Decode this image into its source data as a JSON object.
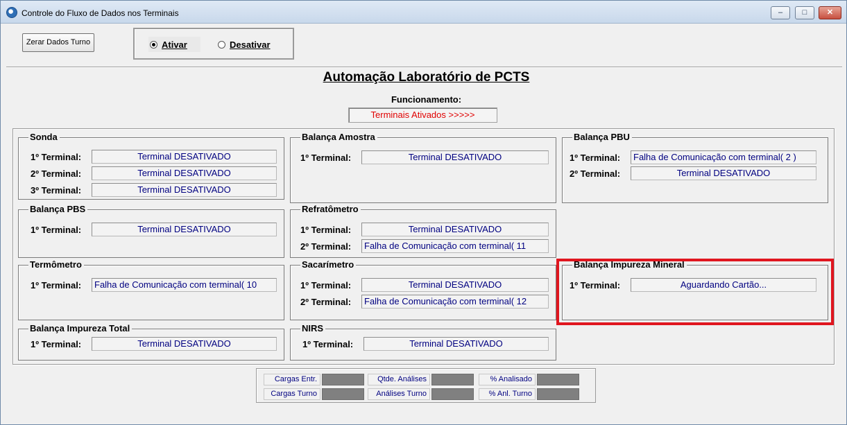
{
  "window": {
    "title": "Controle do Fluxo de Dados nos Terminais",
    "min_glyph": "–",
    "max_glyph": "□",
    "close_glyph": "✕"
  },
  "toolbar": {
    "zerar_label": "Zerar Dados Turno",
    "ativar_label": "Ativar",
    "desativar_label": "Desativar",
    "selected": "Ativar"
  },
  "header": {
    "title": "Automação Laboratório de PCTS",
    "func_label": "Funcionamento:",
    "func_status": "Terminais Ativados >>>>>"
  },
  "groups": {
    "sonda": {
      "title": "Sonda",
      "rows": [
        {
          "label": "1º Terminal:",
          "value": "Terminal DESATIVADO"
        },
        {
          "label": "2º Terminal:",
          "value": "Terminal DESATIVADO"
        },
        {
          "label": "3º Terminal:",
          "value": "Terminal DESATIVADO"
        }
      ]
    },
    "balanca_amostra": {
      "title": "Balança Amostra",
      "rows": [
        {
          "label": "1º Terminal:",
          "value": "Terminal DESATIVADO"
        }
      ]
    },
    "balanca_pbu": {
      "title": "Balança PBU",
      "rows": [
        {
          "label": "1º Terminal:",
          "value": "Falha de Comunicação com terminal( 2 )"
        },
        {
          "label": "2º Terminal:",
          "value": "Terminal DESATIVADO"
        }
      ]
    },
    "balanca_pbs": {
      "title": "Balança PBS",
      "rows": [
        {
          "label": "1º Terminal:",
          "value": "Terminal DESATIVADO"
        }
      ]
    },
    "refratometro": {
      "title": "Refratômetro",
      "rows": [
        {
          "label": "1º Terminal:",
          "value": "Terminal DESATIVADO"
        },
        {
          "label": "2º Terminal:",
          "value": "Falha de Comunicação com terminal( 11"
        }
      ]
    },
    "termometro": {
      "title": "Termômetro",
      "rows": [
        {
          "label": "1º Terminal:",
          "value": "Falha de Comunicação com terminal( 10"
        }
      ]
    },
    "sacarimetro": {
      "title": "Sacarímetro",
      "rows": [
        {
          "label": "1º Terminal:",
          "value": "Terminal DESATIVADO"
        },
        {
          "label": "2º Terminal:",
          "value": "Falha de Comunicação com terminal( 12"
        }
      ]
    },
    "balanca_mineral": {
      "title": "Balança Impureza Mineral",
      "rows": [
        {
          "label": "1º Terminal:",
          "value": "Aguardando Cartão..."
        }
      ]
    },
    "balanca_total": {
      "title": "Balança Impureza Total",
      "rows": [
        {
          "label": "1º Terminal:",
          "value": "Terminal DESATIVADO"
        }
      ]
    },
    "nirs": {
      "title": "NIRS",
      "rows": [
        {
          "label": "1º Terminal:",
          "value": "Terminal DESATIVADO"
        }
      ]
    }
  },
  "stats": {
    "cargas_entr": "Cargas Entr.",
    "qtde_analises": "Qtde. Análises",
    "pct_analisado": "% Analisado",
    "cargas_turno": "Cargas Turno",
    "analises_turno": "Análises Turno",
    "pct_anl_turno": "% Anl. Turno"
  }
}
